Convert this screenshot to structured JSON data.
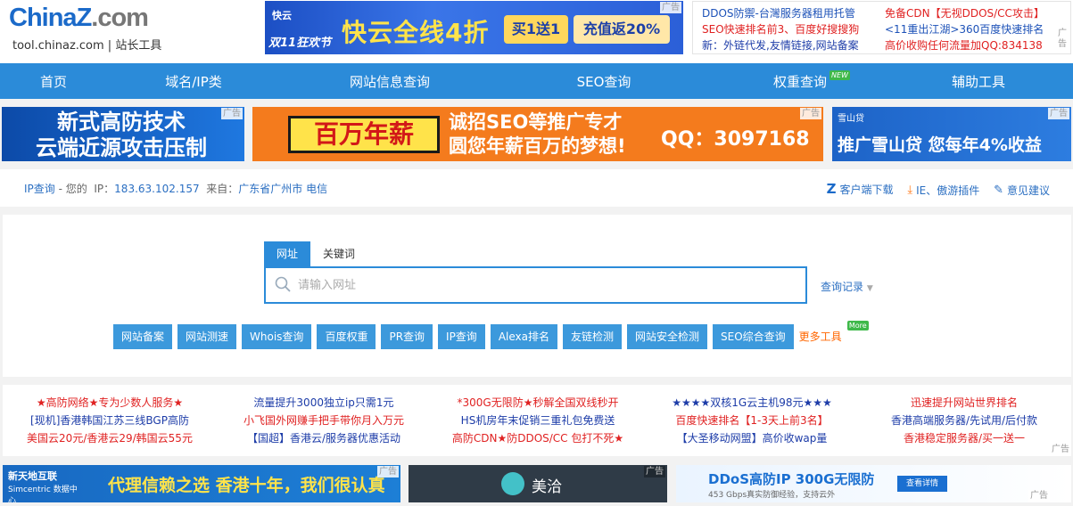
{
  "logo": {
    "main_a": "China",
    "main_z": "Z",
    "main_b": ".com",
    "sub": "tool.chinaz.com | 站长工具"
  },
  "ad_label": "广告",
  "top_banner": {
    "brand": "快云",
    "festival": "双11狂欢节",
    "headline": "快云全线4折",
    "offer1": "买1送1",
    "offer2": "充值返20%"
  },
  "top_links": {
    "col1": [
      "DDOS防禦-台灣服务器租用托管",
      "SEO快速排名前3、百度好搜搜狗",
      "新：外链代发,友情链接,网站备案"
    ],
    "col2": [
      "免备CDN【无视DDOS/CC攻击】",
      "<11重出江湖>360百度快速排名",
      "高价收购任何流量加QQ:834138"
    ]
  },
  "nav": [
    "首页",
    "域名/IP类",
    "网站信息查询",
    "SEO查询",
    "权重查询",
    "辅助工具"
  ],
  "nav_new": "NEW",
  "ads_row": {
    "left": [
      "新式高防技术",
      "云端近源攻击压制"
    ],
    "mid": {
      "badge": "百万年薪",
      "line1": "诚招SEO等推广专才",
      "line2": "圆您年薪百万的梦想!",
      "qq": "QQ：3097168"
    },
    "right": {
      "logo": "雪山贷",
      "text": "推广雪山贷 您每年4%收益"
    }
  },
  "ipbar": {
    "label": "IP查询",
    "dash": " - 您的",
    "ip_label": "IP：",
    "ip": "183.63.102.157",
    "from_label": "来自：",
    "location": "广东省广州市 电信"
  },
  "tools": [
    "客户端下载",
    "IE、傲游插件",
    "意见建议"
  ],
  "search": {
    "tabs": [
      "网址",
      "关键词"
    ],
    "placeholder": "请输入网址",
    "history": "查询记录",
    "quick": [
      "网站备案",
      "网站测速",
      "Whois查询",
      "百度权重",
      "PR查询",
      "IP查询",
      "Alexa排名",
      "友链检测",
      "网站安全检测",
      "SEO综合查询"
    ],
    "more": "更多工具",
    "more_badge": "More"
  },
  "text_ads": [
    [
      "★高防网络★专为少数人服务★",
      "[现机]香港韩国江苏三线BGP高防",
      "美国云20元/香港云29/韩国云55元"
    ],
    [
      "流量提升3000独立ip只需1元",
      "小飞国外网赚手把手带你月入万元",
      "【国超】香港云/服务器优惠活动"
    ],
    [
      "*300G无限防★秒解全国双线秒开",
      "HS机房年末促销三重礼包免费送",
      "高防CDN★防DDOS/CC 包打不死★"
    ],
    [
      "★★★★双核1G云主机98元★★★",
      "百度快速排名【1-3天上前3名】",
      "【大圣移动网盟】高价收wap量"
    ],
    [
      "迅速提升网站世界排名",
      "香港高端服务器/先试用/后付款",
      "香港稳定服务器/买一送一"
    ]
  ],
  "bottom_ads": {
    "b1": {
      "logo": "新天地互联",
      "logo_sub": "Simcentric 数据中心",
      "text": "代理信赖之选 香港十年，我们很认真"
    },
    "b2": {
      "text": "美洽"
    },
    "b3": {
      "title": "DDoS高防IP 300G无限防",
      "sub": "453 Gbps真实防御经验，支持云外",
      "btn": "查看详情"
    }
  }
}
